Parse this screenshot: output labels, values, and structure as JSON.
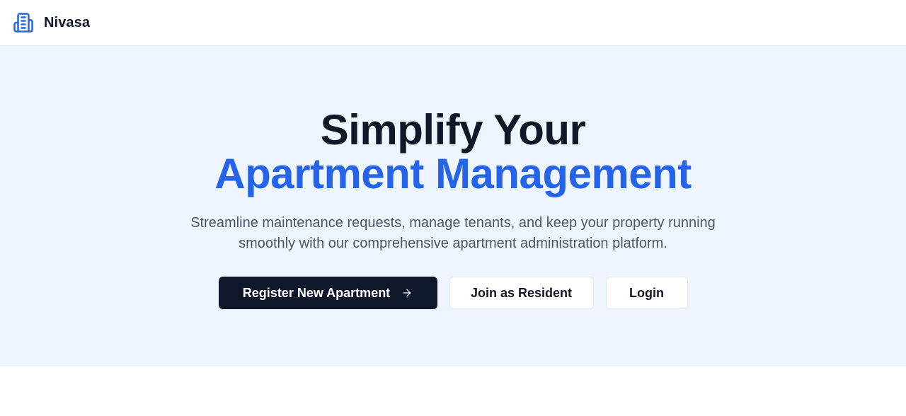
{
  "brand": {
    "name": "Nivasa",
    "icon": "building-icon",
    "accent_color": "#2563eb"
  },
  "hero": {
    "title_line1": "Simplify Your",
    "title_line2": "Apartment Management",
    "subtitle": "Streamline maintenance requests, manage tenants, and keep your property running smoothly with our comprehensive apartment administration platform.",
    "background_color": "#eef5fe"
  },
  "actions": {
    "register_label": "Register New Apartment",
    "register_icon": "arrow-right-icon",
    "join_label": "Join as Resident",
    "login_label": "Login"
  }
}
